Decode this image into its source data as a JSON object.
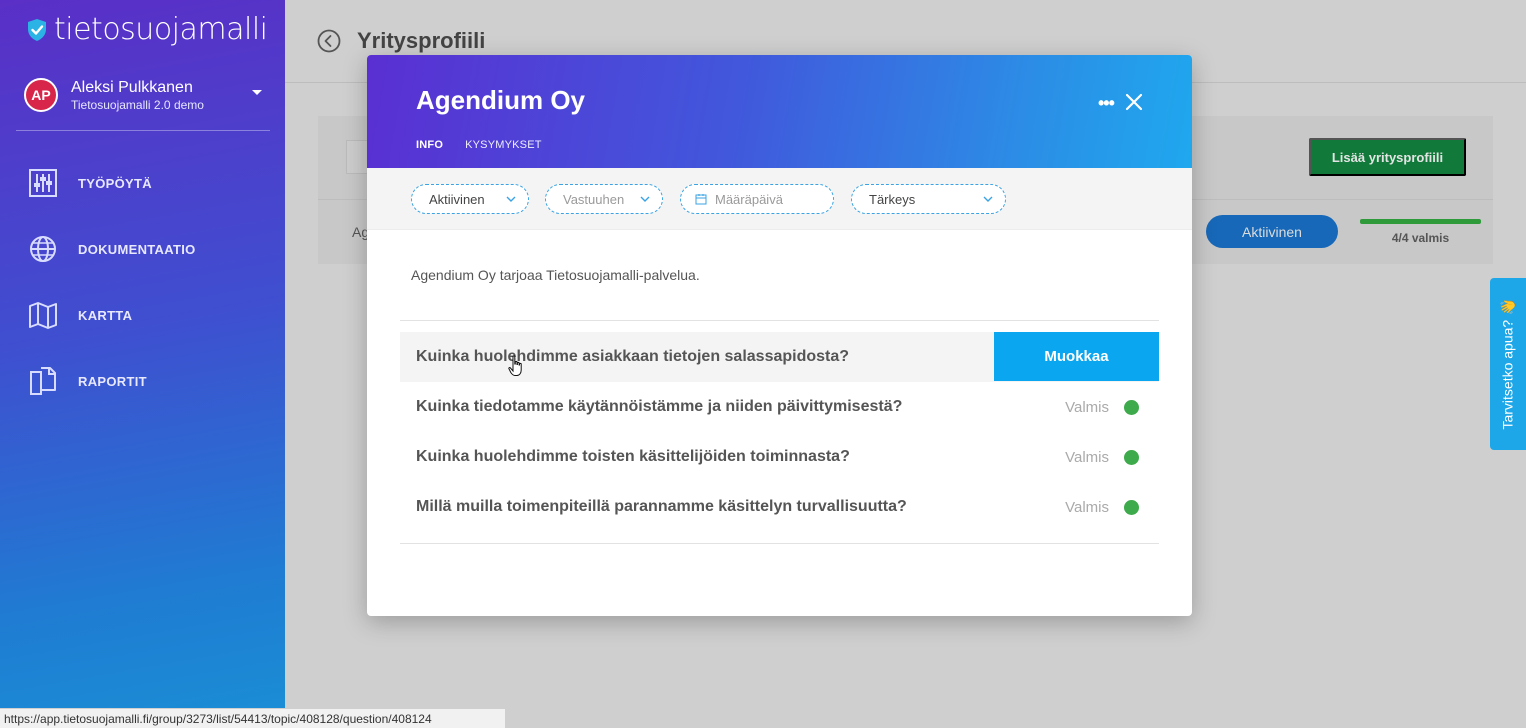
{
  "app": {
    "logo_text": "tietosuojamalli"
  },
  "user": {
    "initials": "AP",
    "name": "Aleksi Pulkkanen",
    "org": "Tietosuojamalli 2.0 demo"
  },
  "sidebar": {
    "items": [
      {
        "label": "TYÖPÖYTÄ",
        "icon": "sliders-icon"
      },
      {
        "label": "DOKUMENTAATIO",
        "icon": "globe-icon"
      },
      {
        "label": "KARTTA",
        "icon": "map-icon"
      },
      {
        "label": "RAPORTIT",
        "icon": "documents-icon"
      }
    ]
  },
  "page": {
    "title": "Yritysprofiili",
    "add_button": "Lisää yritysprofiili",
    "row_text": "Ag",
    "row_status": "Aktiivinen",
    "row_progress_text": "4/4 valmis",
    "row_progress": 1.0
  },
  "help": {
    "label": "Tarvitsetko apua? 👋"
  },
  "modal": {
    "title": "Agendium Oy",
    "more": "•••",
    "tabs": [
      {
        "label": "INFO",
        "active": true
      },
      {
        "label": "KYSYMYKSET",
        "active": false
      }
    ],
    "filters": {
      "status": "Aktiivinen",
      "responsible_placeholder": "Vastuuhen",
      "due_placeholder": "Määräpäivä",
      "priority": "Tärkeys"
    },
    "description": "Agendium Oy tarjoaa Tietosuojamalli-palvelua.",
    "questions": [
      {
        "text": "Kuinka huolehdimme asiakkaan tietojen salassapidosta?",
        "action": "Muokkaa"
      },
      {
        "text": "Kuinka tiedotamme käytännöistämme ja niiden päivittymisestä?",
        "status": "Valmis"
      },
      {
        "text": "Kuinka huolehdimme toisten käsittelijöiden toiminnasta?",
        "status": "Valmis"
      },
      {
        "text": "Millä muilla toimenpiteillä parannamme käsittelyn turvallisuutta?",
        "status": "Valmis"
      }
    ]
  },
  "statusbar": {
    "url": "https://app.tietosuojamalli.fi/group/3273/list/54413/topic/408128/question/408124"
  },
  "colors": {
    "accent": "#0aa6f0",
    "success": "#3daa4b",
    "primary_button": "#117a3a"
  }
}
